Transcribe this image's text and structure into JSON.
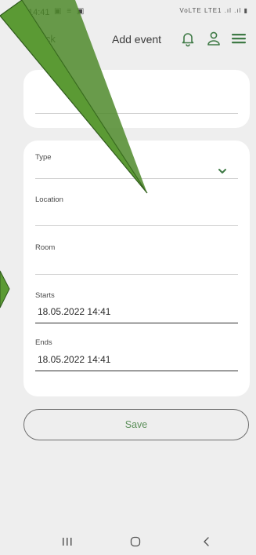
{
  "status_bar": {
    "time": "14:41",
    "notification_icons": "▣ ≡ ▣",
    "network": "VoLTE LTE1 .ıl .ıl ▮"
  },
  "header": {
    "back_label": "Back",
    "title": "Add event"
  },
  "icons": {
    "bell": "bell-icon",
    "user": "user-icon",
    "menu": "hamburger-menu-icon"
  },
  "form": {
    "type": {
      "label": "Type",
      "value": ""
    },
    "location": {
      "label": "Location",
      "value": ""
    },
    "room": {
      "label": "Room",
      "value": ""
    },
    "starts": {
      "label": "Starts",
      "value": "18.05.2022 14:41"
    },
    "ends": {
      "label": "Ends",
      "value": "18.05.2022 14:41"
    }
  },
  "actions": {
    "save_label": "Save"
  },
  "colors": {
    "accent": "#5c8f5a",
    "annotation_arrow": "#5b9a34",
    "background": "#eeeeee",
    "card": "#ffffff"
  }
}
